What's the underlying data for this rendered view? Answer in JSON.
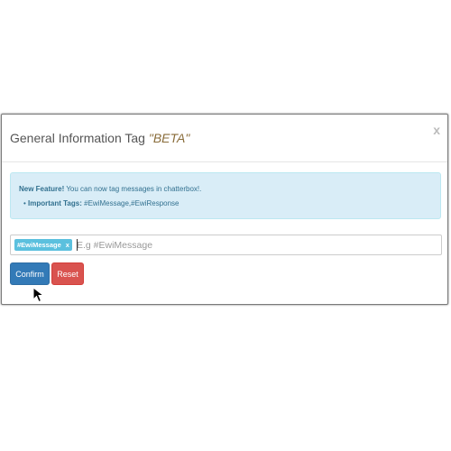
{
  "modal": {
    "title": "General Information Tag ",
    "title_beta": "\"BETA\"",
    "close_label": "x"
  },
  "alert": {
    "feature_label": "New Feature!",
    "feature_text": " You can now tag messages in chatterbox!.",
    "bullet": "• ",
    "tags_label": "Important Tags:",
    "tags_text": " #EwiMessage,#EwiResponse"
  },
  "tag_input": {
    "chip_label": "#EwiMessage",
    "chip_remove": "x",
    "placeholder": "E.g #EwiMessage"
  },
  "buttons": {
    "confirm_label": "Confirm",
    "reset_label": "Reset"
  },
  "colors": {
    "primary": "#337ab7",
    "danger": "#d9534f",
    "info_bg": "#d9edf7",
    "info_text": "#31708f",
    "tag_chip": "#5bc0de",
    "beta": "#8a6d3b"
  },
  "icons": {
    "close": "close-icon",
    "cursor": "mouse-pointer-icon"
  }
}
